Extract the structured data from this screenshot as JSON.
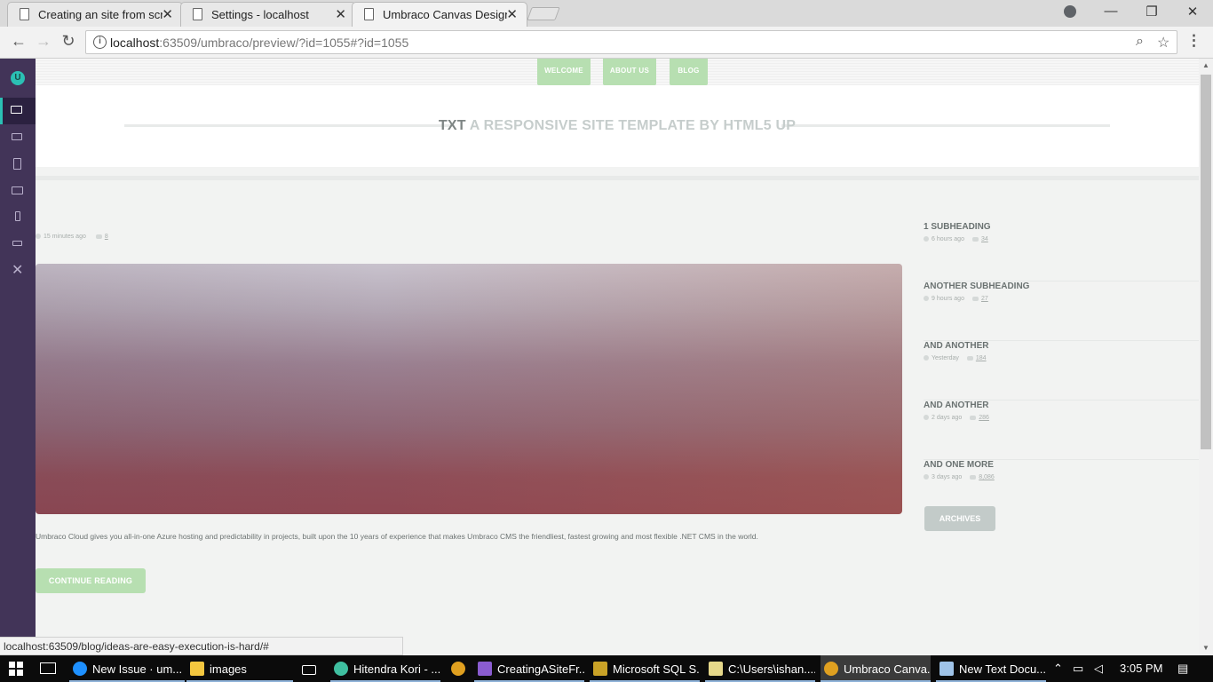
{
  "browser": {
    "tabs": [
      {
        "title": "Creating an site from scra",
        "active": false
      },
      {
        "title": "Settings - localhost",
        "active": false
      },
      {
        "title": "Umbraco Canvas Designe",
        "active": true
      }
    ],
    "url_host": "localhost",
    "url_rest": ":63509/umbraco/preview/?id=1055#?id=1055",
    "status_url": "localhost:63509/blog/ideas-are-easy-execution-is-hard/#"
  },
  "umbraco": {
    "logo_letter": "U",
    "devices": [
      "desktop",
      "laptop",
      "tablet-portrait",
      "tablet-landscape",
      "smartphone-portrait",
      "smartphone-landscape"
    ],
    "active_device": "desktop"
  },
  "site": {
    "nav": [
      "WELCOME",
      "ABOUT US",
      "BLOG"
    ],
    "banner_strong": "TXT",
    "banner_rest": "A RESPONSIVE SITE TEMPLATE BY HTML5 UP",
    "post": {
      "time": "15 minutes ago",
      "comments": "8",
      "excerpt": "Umbraco Cloud gives you all-in-one Azure hosting and predictability in projects, built upon the 10 years of experience that makes Umbraco CMS the friendliest, fastest growing and most flexible .NET CMS in the world.",
      "continue_label": "CONTINUE READING"
    },
    "sidebar": [
      {
        "title": "1 SUBHEADING",
        "time": "6 hours ago",
        "comments": "34"
      },
      {
        "title": "ANOTHER SUBHEADING",
        "time": "9 hours ago",
        "comments": "27"
      },
      {
        "title": "AND ANOTHER",
        "time": "Yesterday",
        "comments": "184"
      },
      {
        "title": "AND ANOTHER",
        "time": "2 days ago",
        "comments": "286"
      },
      {
        "title": "AND ONE MORE",
        "time": "3 days ago",
        "comments": "8,086"
      }
    ],
    "archives_label": "ARCHIVES"
  },
  "taskbar": {
    "items": [
      {
        "label": "New Issue · um...",
        "icon": "edge-icon",
        "color": "#1e90ff"
      },
      {
        "label": "images",
        "icon": "folder-icon",
        "color": "#f3c63f"
      },
      {
        "label": "",
        "icon": "mail-icon",
        "color": "#ffffff"
      },
      {
        "label": "Hitendra Kori - ...",
        "icon": "app-icon",
        "color": "#3fbfa0"
      },
      {
        "label": "",
        "icon": "chrome-icon",
        "color": "#e0a020"
      },
      {
        "label": "CreatingASiteFr...",
        "icon": "visual-studio-icon",
        "color": "#8a5cd0"
      },
      {
        "label": "Microsoft SQL S...",
        "icon": "sql-server-icon",
        "color": "#c9a227"
      },
      {
        "label": "C:\\Users\\ishan....",
        "icon": "notepad-icon",
        "color": "#e6d88a"
      },
      {
        "label": "Umbraco Canva...",
        "icon": "chrome-icon",
        "color": "#e0a020"
      },
      {
        "label": "New Text Docu...",
        "icon": "notepad-icon",
        "color": "#9fc3e8"
      }
    ],
    "time": "3:05 PM"
  }
}
